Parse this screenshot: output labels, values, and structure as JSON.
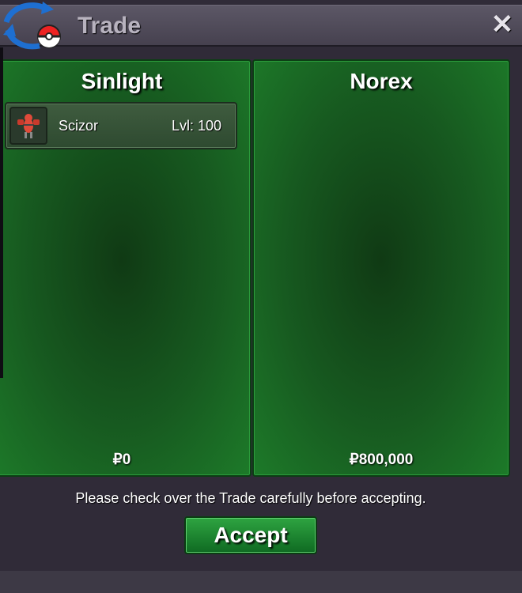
{
  "window": {
    "title": "Trade",
    "close_label": "✕"
  },
  "left_panel": {
    "player_name": "Sinlight",
    "items": [
      {
        "name": "Scizor",
        "level": "Lvl: 100"
      }
    ],
    "money": "₽0"
  },
  "right_panel": {
    "player_name": "Norex",
    "items": [],
    "money": "₽800,000"
  },
  "notice": "Please check over the Trade carefully before accepting.",
  "accept_label": "Accept",
  "colors": {
    "panel_green": "#1d7a29",
    "button_green": "#2ea441",
    "titlebar": "#5c5766"
  }
}
